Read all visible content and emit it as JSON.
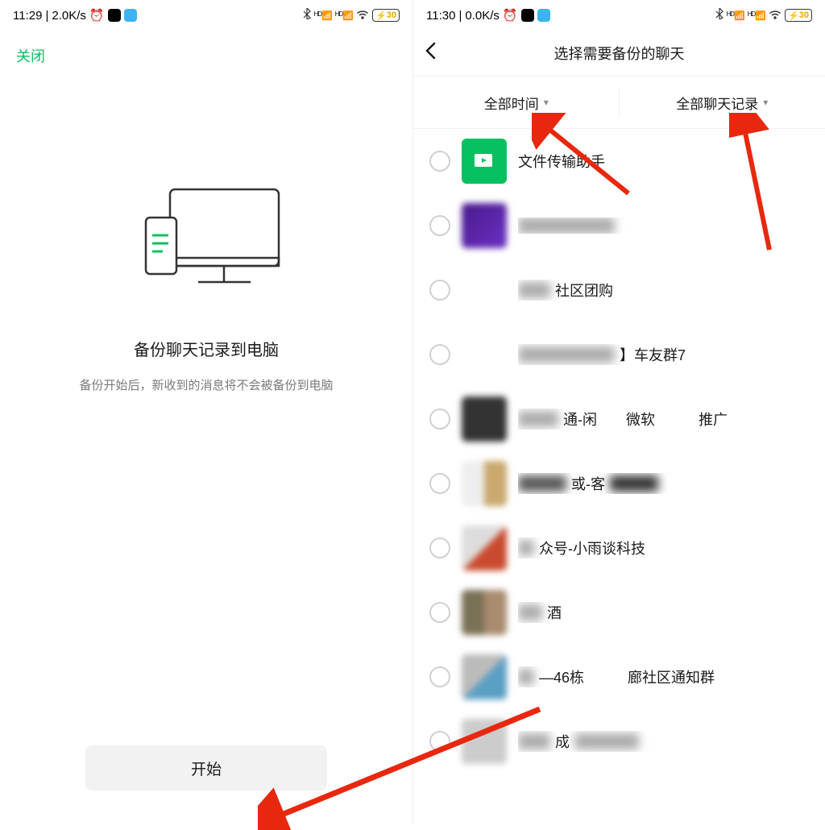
{
  "left": {
    "status": {
      "time": "11:29",
      "speed": "2.0K/s",
      "battery": "30"
    },
    "close_label": "关闭",
    "title": "备份聊天记录到电脑",
    "subtitle": "备份开始后，新收到的消息将不会被备份到电脑",
    "start_label": "开始"
  },
  "right": {
    "status": {
      "time": "11:30",
      "speed": "0.0K/s",
      "battery": "30"
    },
    "nav_title": "选择需要备份的聊天",
    "filter_time": "全部时间",
    "filter_scope": "全部聊天记录",
    "chats": [
      {
        "name": "文件传输助手",
        "avatar": "green"
      },
      {
        "name": "",
        "avatar": "purple"
      },
      {
        "name": "社区团购",
        "avatar": "collage1"
      },
      {
        "name": "】车友群7",
        "avatar": "collage2"
      },
      {
        "name": "通-闲　　微软　　　推广",
        "avatar": "blur1"
      },
      {
        "name": "或-客",
        "avatar": "blur2"
      },
      {
        "name": "众号-小雨谈科技",
        "avatar": "blur3"
      },
      {
        "name": "酒",
        "avatar": "blur4"
      },
      {
        "name": "—46栋　　　廊社区通知群",
        "avatar": "blur5"
      },
      {
        "name": "成",
        "avatar": "blur6"
      }
    ]
  }
}
